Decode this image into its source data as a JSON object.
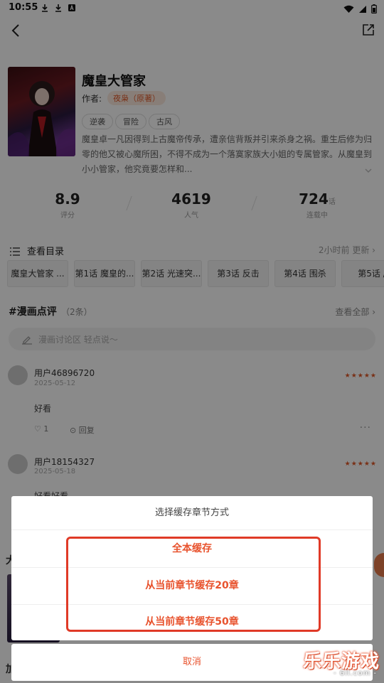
{
  "status_bar": {
    "time": "10:55",
    "icons": [
      "download-icon",
      "download-icon",
      "app-notification-icon",
      "wifi-icon",
      "signal-icon",
      "battery-icon"
    ]
  },
  "header": {
    "back_icon": "back-arrow-icon",
    "share_icon": "share-icon"
  },
  "book": {
    "title": "魔皇大管家",
    "author_label": "作者:",
    "author": "夜枭（原著）",
    "tags": [
      "逆袭",
      "冒险",
      "古风"
    ],
    "description": "魔皇卓一凡因得到上古魔帝传承，遭亲信背叛并引来杀身之祸。重生后修为归零的他又被心魔所困，不得不成为一个落寞家族大小姐的专属管家。从魔皇到小小管家，他究竟要怎样和..."
  },
  "stats": [
    {
      "value": "8.9",
      "unit": "",
      "label": "评分"
    },
    {
      "value": "4619",
      "unit": "",
      "label": "人气"
    },
    {
      "value": "724",
      "unit": "话",
      "label": "连载中"
    }
  ],
  "catalog": {
    "label": "查看目录",
    "update": "2小时前 更新 ›",
    "chapters": [
      "魔皇大管家 ...",
      "第1话 魔皇的...",
      "第2话 光速突...",
      "第3话 反击",
      "第4话 围杀",
      "第5话 /"
    ]
  },
  "comments": {
    "title": "#漫画点评",
    "count": "（2条）",
    "see_all": "查看全部 ›",
    "input_placeholder": "漫画讨论区 轻点说～",
    "items": [
      {
        "user": "用户46896720",
        "date": "2025-05-12",
        "rating": 5,
        "text": "好看",
        "likes": "1",
        "reply_label": "回复"
      },
      {
        "user": "用户18154327",
        "date": "2025-05-18",
        "rating": 5,
        "text": "好看好看"
      }
    ]
  },
  "background_fragments": {
    "char_top": "大",
    "char_bottom": "加"
  },
  "dialog": {
    "title": "选择缓存章节方式",
    "options": [
      "全本缓存",
      "从当前章节缓存20章",
      "从当前章节缓存50章"
    ],
    "cancel": "取消",
    "accent_color": "#e8532e",
    "highlight_color": "#e03a27"
  },
  "watermark": {
    "title": "乐乐游戏",
    "subtitle": "- 6ll.com -"
  }
}
